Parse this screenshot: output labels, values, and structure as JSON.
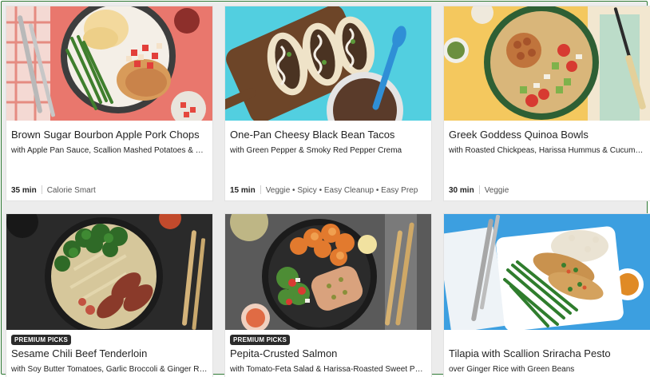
{
  "recipes": [
    {
      "title": "Brown Sugar Bourbon Apple Pork Chops",
      "subtitle": "with Apple Pan Sauce, Scallion Mashed Potatoes & Green Beans",
      "time": "35 min",
      "tags": "Calorie Smart",
      "image": "pork-chop-plate-image"
    },
    {
      "title": "One-Pan Cheesy Black Bean Tacos",
      "subtitle": "with Green Pepper & Smoky Red Pepper Crema",
      "time": "15 min",
      "tags": "Veggie • Spicy • Easy Cleanup • Easy Prep",
      "image": "black-bean-tacos-image"
    },
    {
      "title": "Greek Goddess Quinoa Bowls",
      "subtitle": "with Roasted Chickpeas, Harissa Hummus & Cucumber Salad",
      "time": "30 min",
      "tags": "Veggie",
      "image": "quinoa-bowl-image"
    },
    {
      "badge": "PREMIUM PICKS",
      "title": "Sesame Chili Beef Tenderloin",
      "subtitle": "with Soy Butter Tomatoes, Garlic Broccoli & Ginger Rice",
      "image": "beef-tenderloin-image"
    },
    {
      "badge": "PREMIUM PICKS",
      "title": "Pepita-Crusted Salmon",
      "subtitle": "with Tomato-Feta Salad & Harissa-Roasted Sweet Potatoes",
      "image": "salmon-plate-image"
    },
    {
      "title": "Tilapia with Scallion Sriracha Pesto",
      "subtitle": "over Ginger Rice with Green Beans",
      "image": "tilapia-plate-image"
    }
  ]
}
